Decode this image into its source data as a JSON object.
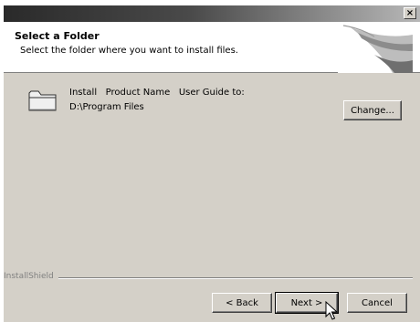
{
  "window": {
    "close_glyph": "×"
  },
  "header": {
    "title": "Select a Folder",
    "subtitle": "Select the folder where you want to install files."
  },
  "body": {
    "install_line": "Install   Product Name   User Guide to:",
    "path": "D:\\Program Files",
    "change_label": "Change..."
  },
  "footer": {
    "brand": "InstallShield",
    "back_label": "< Back",
    "next_label": "Next >",
    "cancel_label": "Cancel"
  },
  "icons": {
    "folder": "folder-icon",
    "close": "close-icon",
    "cursor": "mouse-pointer-icon",
    "header_graphic": "installshield-swoosh-graphic"
  },
  "colors": {
    "dialog_face": "#d4d0c8",
    "title_bar_start": "#2a2a2a",
    "title_bar_end": "#b8b8b8",
    "header_background": "#ffffff",
    "brand_text": "#808080"
  }
}
